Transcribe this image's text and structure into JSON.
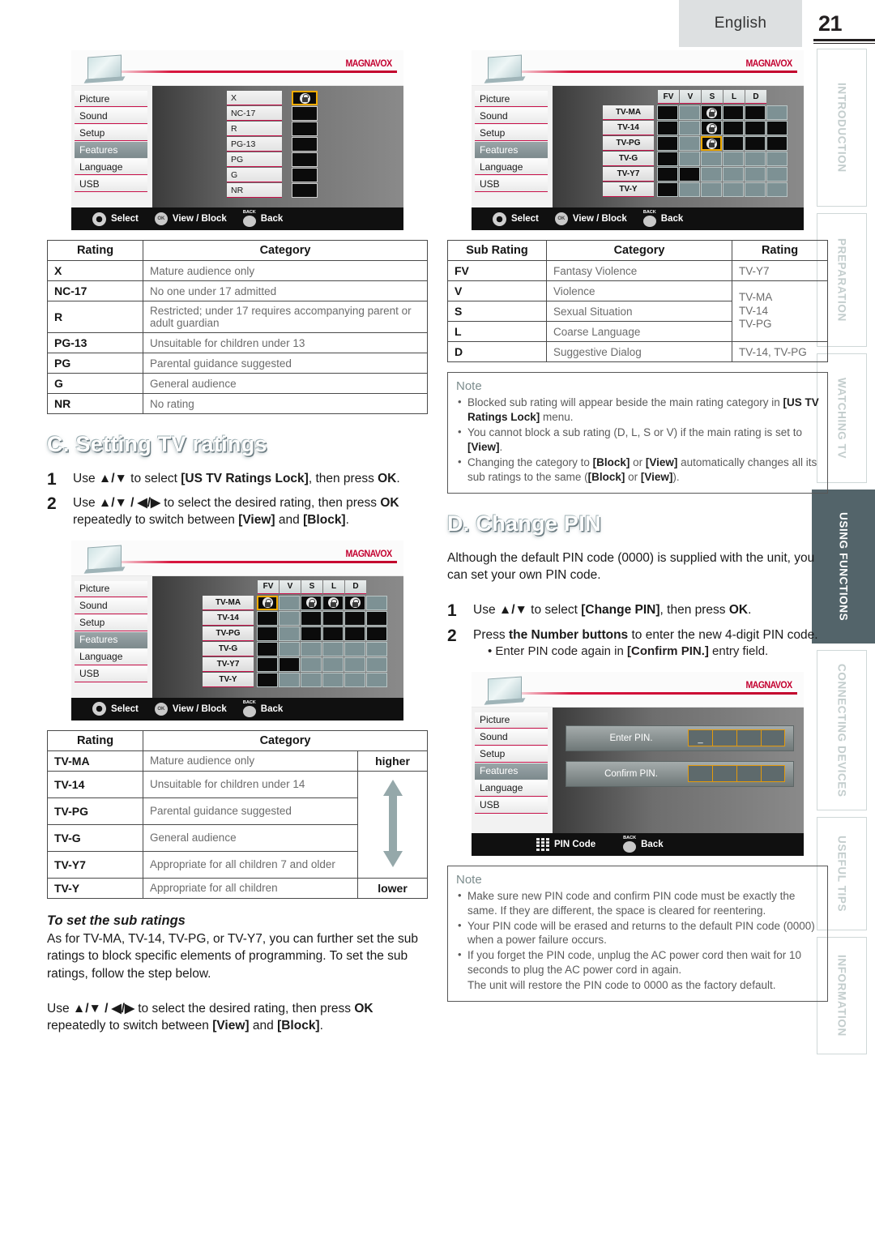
{
  "header": {
    "language": "English",
    "page_number": "21"
  },
  "side_tabs": [
    {
      "label": "INTRODUCTION",
      "active": false
    },
    {
      "label": "PREPARATION",
      "active": false
    },
    {
      "label": "WATCHING TV",
      "active": false
    },
    {
      "label": "USING FUNCTIONS",
      "active": true
    },
    {
      "label": "CONNECTING DEVICES",
      "active": false
    },
    {
      "label": "USEFUL TIPS",
      "active": false
    },
    {
      "label": "INFORMATION",
      "active": false
    }
  ],
  "tv_menu": {
    "items": [
      "Picture",
      "Sound",
      "Setup",
      "Features",
      "Language",
      "USB"
    ],
    "selected": "Features",
    "brand": "MAGNAVOX"
  },
  "tv_footer": {
    "select": "Select",
    "view_block": "View / Block",
    "back": "Back",
    "back_glyph": "BACK",
    "ok_glyph": "OK",
    "pin_code": "PIN Code"
  },
  "screen_movie_ratings": {
    "rows": [
      {
        "name": "X",
        "locked": true,
        "cursor": true
      },
      {
        "name": "NC-17",
        "locked": false,
        "cursor": false
      },
      {
        "name": "R",
        "locked": false,
        "cursor": false
      },
      {
        "name": "PG-13",
        "locked": false,
        "cursor": false
      },
      {
        "name": "PG",
        "locked": false,
        "cursor": false
      },
      {
        "name": "G",
        "locked": false,
        "cursor": false
      },
      {
        "name": "NR",
        "locked": false,
        "cursor": false
      }
    ]
  },
  "screen_tv_ratings_main": {
    "columns": [
      "FV",
      "V",
      "S",
      "L",
      "D"
    ],
    "rows": [
      {
        "name": "TV-MA",
        "main": "off",
        "cells": [
          "on",
          "lock",
          "off",
          "off",
          "on"
        ]
      },
      {
        "name": "TV-14",
        "main": "off",
        "cells": [
          "on",
          "lock",
          "off",
          "off",
          "off"
        ]
      },
      {
        "name": "TV-PG",
        "main": "off",
        "cells": [
          "on",
          "lock-cursor",
          "off",
          "off",
          "off"
        ]
      },
      {
        "name": "TV-G",
        "main": "off",
        "cells": [
          "on",
          "on",
          "on",
          "on",
          "on"
        ]
      },
      {
        "name": "TV-Y7",
        "main": "off",
        "cells": [
          "off",
          "on",
          "on",
          "on",
          "on"
        ]
      },
      {
        "name": "TV-Y",
        "main": "off",
        "cells": [
          "on",
          "on",
          "on",
          "on",
          "on"
        ]
      }
    ]
  },
  "screen_tv_ratings_sub": {
    "columns": [
      "FV",
      "V",
      "S",
      "L",
      "D"
    ],
    "rows": [
      {
        "name": "TV-MA",
        "main": "lock-cursor",
        "cells": [
          "on",
          "lock",
          "lock",
          "lock",
          "on"
        ]
      },
      {
        "name": "TV-14",
        "main": "off",
        "cells": [
          "on",
          "off",
          "off",
          "off",
          "off"
        ]
      },
      {
        "name": "TV-PG",
        "main": "off",
        "cells": [
          "on",
          "off",
          "off",
          "off",
          "off"
        ]
      },
      {
        "name": "TV-G",
        "main": "off",
        "cells": [
          "on",
          "on",
          "on",
          "on",
          "on"
        ]
      },
      {
        "name": "TV-Y7",
        "main": "off",
        "cells": [
          "off",
          "on",
          "on",
          "on",
          "on"
        ]
      },
      {
        "name": "TV-Y",
        "main": "off",
        "cells": [
          "on",
          "on",
          "on",
          "on",
          "on"
        ]
      }
    ]
  },
  "screen_pin": {
    "enter_label": "Enter PIN.",
    "confirm_label": "Confirm PIN.",
    "enter_values": [
      "_",
      "",
      "",
      ""
    ],
    "confirm_values": [
      "",
      "",
      "",
      ""
    ]
  },
  "table_movie_ratings": {
    "headers": [
      "Rating",
      "Category"
    ],
    "rows": [
      [
        "X",
        "Mature audience only"
      ],
      [
        "NC-17",
        "No one under 17 admitted"
      ],
      [
        "R",
        "Restricted; under 17 requires accompanying parent or adult guardian"
      ],
      [
        "PG-13",
        "Unsuitable for children under 13"
      ],
      [
        "PG",
        "Parental guidance suggested"
      ],
      [
        "G",
        "General audience"
      ],
      [
        "NR",
        "No rating"
      ]
    ]
  },
  "table_sub_ratings": {
    "headers": [
      "Sub Rating",
      "Category",
      "Rating"
    ],
    "rows": [
      {
        "sub": "FV",
        "category": "Fantasy Violence",
        "rating": "TV-Y7",
        "rating_rowspan": 1
      },
      {
        "sub": "V",
        "category": "Violence",
        "rating": "TV-MA\nTV-14\nTV-PG",
        "rating_rowspan": 3
      },
      {
        "sub": "S",
        "category": "Sexual Situation",
        "rating": null
      },
      {
        "sub": "L",
        "category": "Coarse Language",
        "rating": null
      },
      {
        "sub": "D",
        "category": "Suggestive Dialog",
        "rating": "TV-14, TV-PG",
        "rating_rowspan": 1
      }
    ]
  },
  "table_tv_ratings": {
    "headers": [
      "Rating",
      "Category"
    ],
    "higher_label": "higher",
    "lower_label": "lower",
    "rows": [
      [
        "TV-MA",
        "Mature audience only"
      ],
      [
        "TV-14",
        "Unsuitable for children under 14"
      ],
      [
        "TV-PG",
        "Parental guidance suggested"
      ],
      [
        "TV-G",
        "General audience"
      ],
      [
        "TV-Y7",
        "Appropriate for all children 7 and older"
      ],
      [
        "TV-Y",
        "Appropriate for all children"
      ]
    ]
  },
  "section_c": {
    "title": "C. Setting TV ratings",
    "steps": [
      {
        "num": "1",
        "text": "Use ▲/▼ to select [US TV Ratings Lock], then press OK."
      },
      {
        "num": "2",
        "text": "Use ▲/▼ / ◀/▶ to select the desired rating, then press OK repeatedly to switch between [View] and [Block]."
      }
    ],
    "sub_title": "To set the sub ratings",
    "sub_para": "As for TV-MA, TV-14, TV-PG, or TV-Y7, you can further set the sub ratings to block specific elements of programming. To set the sub ratings, follow the step below.",
    "sub_instruction": "Use ▲/▼ / ◀/▶ to select the desired rating, then press OK repeatedly to switch between [View] and [Block]."
  },
  "note_sub_ratings": {
    "title": "Note",
    "items": [
      "Blocked sub rating will appear beside the main rating category in [US TV Ratings Lock] menu.",
      "You cannot block a sub rating (D, L, S or V) if the main rating is set to [View].",
      "Changing the category to [Block] or [View] automatically changes all its sub ratings to the same ([Block] or [View])."
    ]
  },
  "section_d": {
    "title": "D. Change PIN",
    "intro": "Although the default PIN code (0000) is supplied with the unit, you can set your own PIN code.",
    "steps": [
      {
        "num": "1",
        "text": "Use ▲/▼ to select [Change PIN], then press OK."
      },
      {
        "num": "2",
        "text": "Press the Number buttons to enter the new 4-digit PIN code."
      }
    ],
    "bullet": "• Enter PIN code again in [Confirm PIN.] entry field."
  },
  "note_pin": {
    "title": "Note",
    "items": [
      "Make sure new PIN code and confirm PIN code must be exactly the same. If they are different, the space is cleared for reentering.",
      "Your PIN code will be erased and returns to the default PIN code (0000) when a power failure occurs.",
      "If you forget the PIN code, unplug the AC power cord then wait for 10 seconds to plug the AC power cord in again.",
      "The unit will restore the PIN code to 0000 as the factory default."
    ]
  },
  "colors": {
    "accent_red": "#c8114a",
    "cursor_gold": "#f0ab00",
    "tab_active": "#53646a",
    "brand_red": "#c3002f"
  }
}
